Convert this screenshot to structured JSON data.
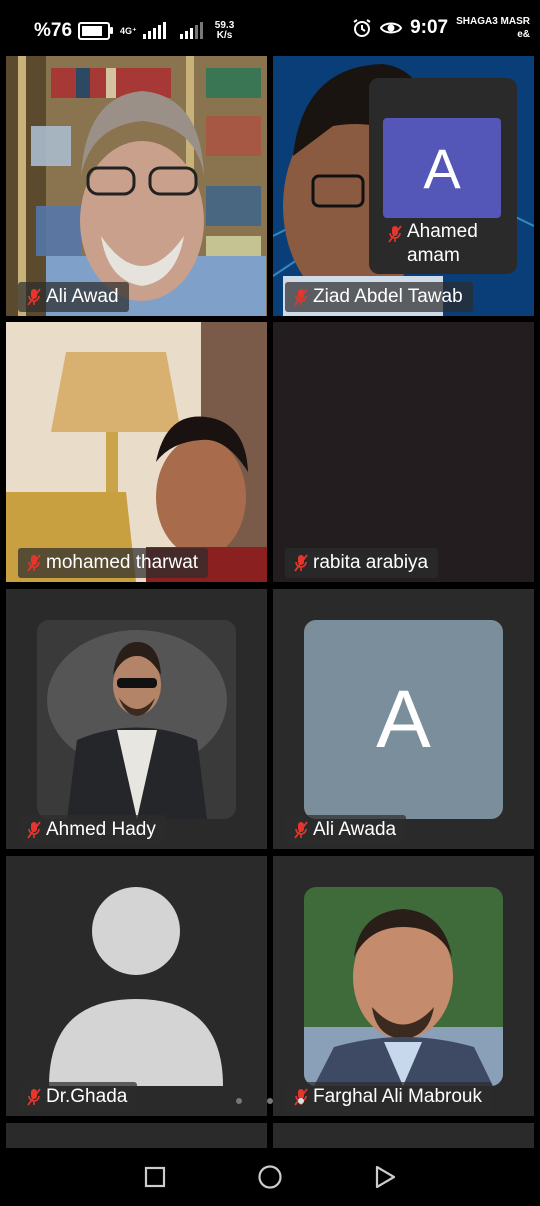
{
  "status_bar": {
    "battery": "%76",
    "network_type": "4G⁺",
    "speed_value": "59.3",
    "speed_unit": "K/s",
    "time": "9:07",
    "carrier_line1": "SHAGA3 MASR",
    "carrier_line2": "e&"
  },
  "participants": [
    {
      "name": "Ali Awad"
    },
    {
      "name": "Ziad Abdel Tawab",
      "pip": {
        "initial": "A",
        "name": "Ahamed amam",
        "name_line1": "Ahamed",
        "name_line2": "amam"
      }
    },
    {
      "name": "mohamed tharwat"
    },
    {
      "name": "rabita arabiya"
    },
    {
      "name": "Ahmed Hady"
    },
    {
      "name": "Ali Awada",
      "initial": "A"
    },
    {
      "name": "Dr.Ghada"
    },
    {
      "name": "Farghal Ali Mabrouk"
    }
  ],
  "colors": {
    "avatar_purple": "#5557b8",
    "avatar_grey": "#7a8f9b",
    "tile_bg": "#231d20",
    "muted_mic": "#e4362c"
  },
  "icons": {
    "mic": "mic-muted-icon",
    "back": "back-triangle-icon",
    "home": "home-circle-icon",
    "recents": "recents-square-icon"
  }
}
